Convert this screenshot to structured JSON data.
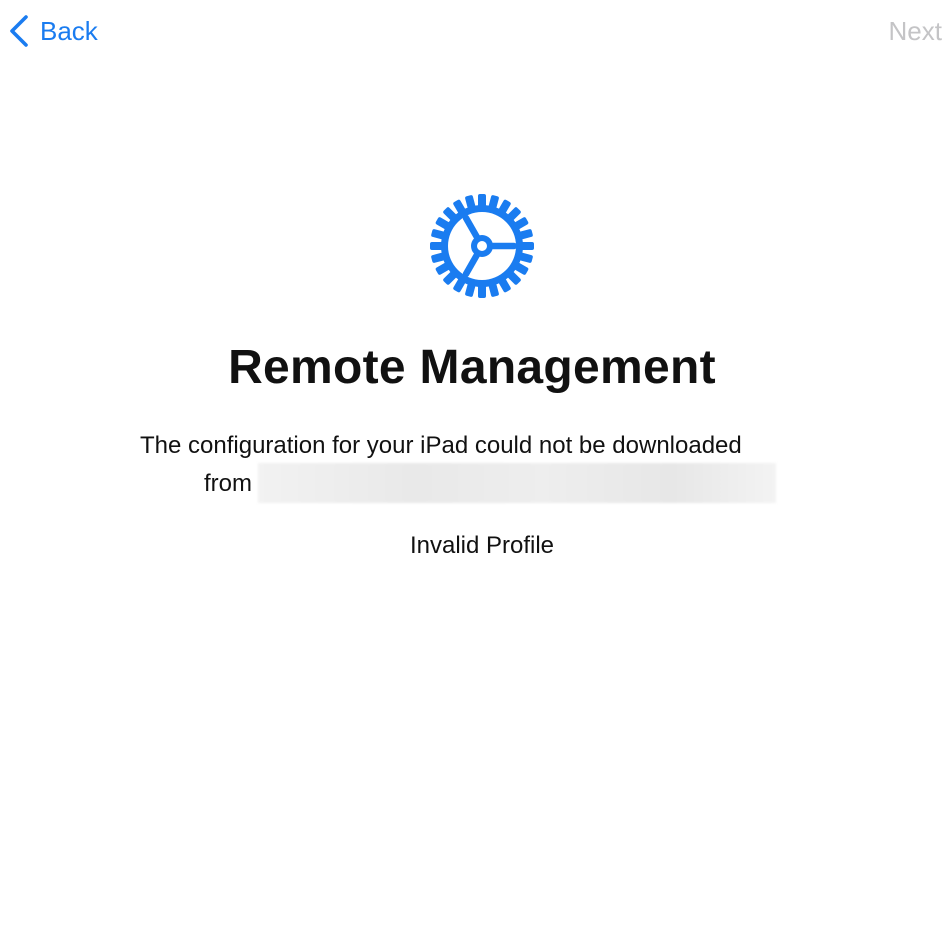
{
  "nav": {
    "back_label": "Back",
    "next_label": "Next",
    "back_color": "#1a7cf0",
    "next_color_disabled": "#c4c4c6"
  },
  "icon": {
    "name": "gear-icon",
    "color": "#1a7cf0"
  },
  "title": "Remote Management",
  "message": {
    "line1": "The configuration for your iPad could not be downloaded",
    "line2_prefix": "from"
  },
  "error": "Invalid Profile"
}
